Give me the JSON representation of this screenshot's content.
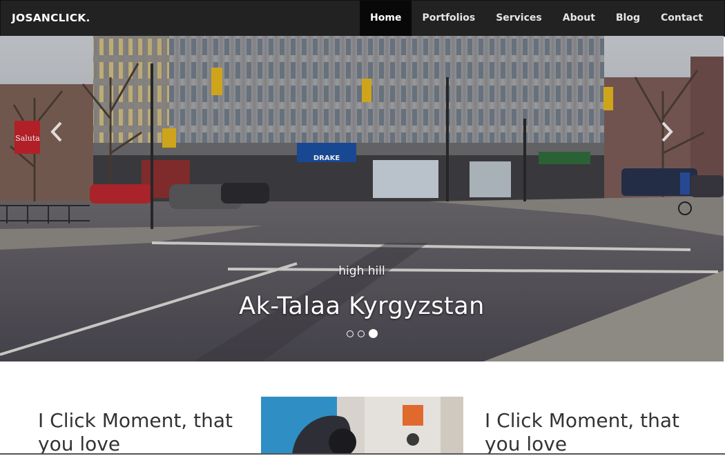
{
  "brand": "JOSANCLICK.",
  "nav": {
    "items": [
      "Home",
      "Portfolios",
      "Services",
      "About",
      "Blog",
      "Contact"
    ],
    "active": "Home"
  },
  "carousel": {
    "subtitle": "high hill",
    "title": "Ak-Talaa Kyrgyzstan",
    "slide_count": 3,
    "active_slide": 3,
    "prev_icon": "chevron-left-icon",
    "next_icon": "chevron-right-icon",
    "sign_text": "Saluta",
    "store_text": "DRAKE"
  },
  "features": {
    "left_text": "I Click Moment, that you love",
    "right_text": "I Click Moment, that you love"
  },
  "colors": {
    "navbar_bg": "#222222",
    "nav_active_bg": "#080808",
    "text_dark": "#333333"
  }
}
